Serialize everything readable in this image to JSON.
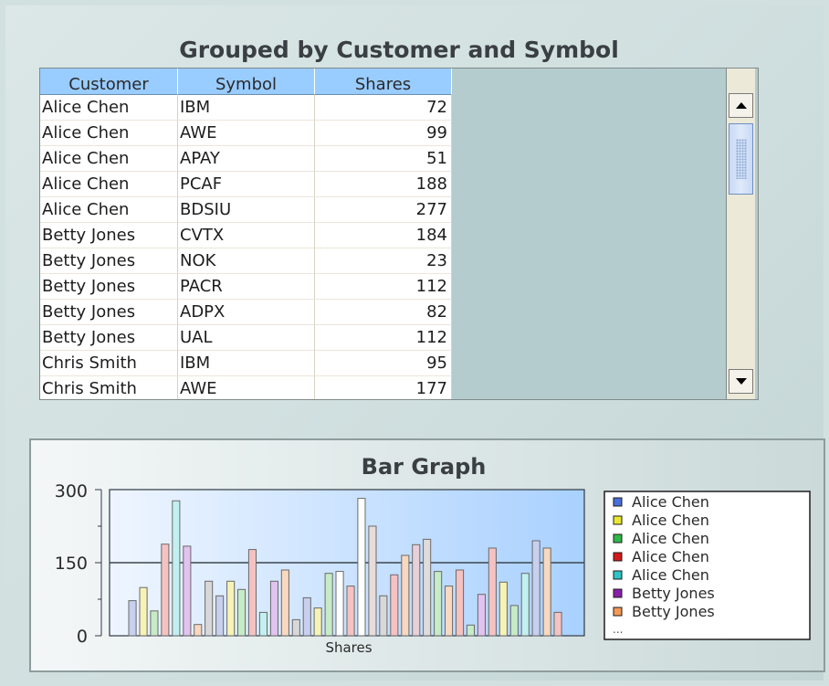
{
  "table": {
    "title": "Grouped by Customer and Symbol",
    "columns": [
      "Customer",
      "Symbol",
      "Shares"
    ],
    "rows": [
      [
        "Alice Chen",
        "IBM",
        "72"
      ],
      [
        "Alice Chen",
        "AWE",
        "99"
      ],
      [
        "Alice Chen",
        "APAY",
        "51"
      ],
      [
        "Alice Chen",
        "PCAF",
        "188"
      ],
      [
        "Alice Chen",
        "BDSIU",
        "277"
      ],
      [
        "Betty Jones",
        "CVTX",
        "184"
      ],
      [
        "Betty Jones",
        "NOK",
        "23"
      ],
      [
        "Betty Jones",
        "PACR",
        "112"
      ],
      [
        "Betty Jones",
        "ADPX",
        "82"
      ],
      [
        "Betty Jones",
        "UAL",
        "112"
      ],
      [
        "Chris Smith",
        "IBM",
        "95"
      ],
      [
        "Chris Smith",
        "AWE",
        "177"
      ]
    ]
  },
  "chart_data": {
    "type": "bar",
    "title": "Bar Graph",
    "xlabel": "Shares",
    "ylabel": "",
    "ylim": [
      0,
      300
    ],
    "yticks": [
      "300",
      "150",
      "0"
    ],
    "grid": "horizontal line at 150",
    "legend_position": "right",
    "legend": [
      {
        "label": "Alice Chen",
        "color": "#4a6fd8"
      },
      {
        "label": "Alice Chen",
        "color": "#e8e830"
      },
      {
        "label": "Alice Chen",
        "color": "#2fb84a"
      },
      {
        "label": "Alice Chen",
        "color": "#d21a1a"
      },
      {
        "label": "Alice Chen",
        "color": "#2ec4c4"
      },
      {
        "label": "Betty Jones",
        "color": "#8a1fa8"
      },
      {
        "label": "Betty Jones",
        "color": "#f49a55"
      }
    ],
    "legend_more": "...",
    "values": [
      72,
      99,
      51,
      188,
      277,
      184,
      23,
      112,
      82,
      112,
      95,
      177,
      48,
      112,
      135,
      33,
      78,
      57,
      128,
      132,
      102,
      282,
      225,
      82,
      125,
      165,
      187,
      198,
      132,
      102,
      135,
      22,
      85,
      180,
      110,
      62,
      128,
      195,
      180,
      48
    ],
    "bar_colors": [
      "#c8d0ee",
      "#f6f3b4",
      "#c6ebc6",
      "#f5c2c2",
      "#c2f0f0",
      "#e2c2ee",
      "#f8d8c0",
      "#d8d8d8",
      "#c8d0ee",
      "#f6f3b4",
      "#c6ebc6",
      "#f5c2c2",
      "#c2f0f0",
      "#e2c2ee",
      "#f8d8c0",
      "#d8d8d8",
      "#c8d0ee",
      "#f6f3b4",
      "#c6ebc6",
      "#ffffff",
      "#f5c2c2",
      "#ffffff",
      "#e8dcd8",
      "#d8d8d8",
      "#f5c2c2",
      "#f8d8c0",
      "#e8d0d8",
      "#e0dcdc",
      "#c6ebc6",
      "#f8d8c0",
      "#f5c2c2",
      "#c6ebc6",
      "#e2c2ee",
      "#f5c2c2",
      "#f6f3b4",
      "#c6ebc6",
      "#c2f0f0",
      "#c8d0ee",
      "#f8d8c0",
      "#f5c2c2"
    ]
  },
  "colors": {
    "header_bg": "#99ccff",
    "plot_gradient_start": "#eef5ff",
    "plot_gradient_end": "#a9d1ff",
    "panel_border": "#8e9c9c"
  }
}
